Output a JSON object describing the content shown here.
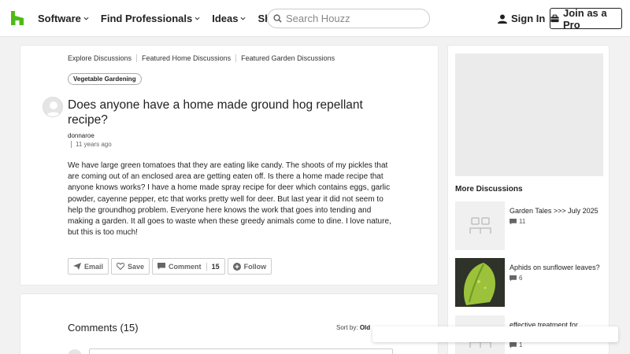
{
  "header": {
    "nav": [
      {
        "label": "Software"
      },
      {
        "label": "Find Professionals"
      },
      {
        "label": "Ideas"
      },
      {
        "label": "Shop"
      }
    ],
    "search_placeholder": "Search Houzz",
    "signin_label": "Sign In",
    "join_label": "Join as a Pro",
    "brand_color": "#4dbc15"
  },
  "breadcrumbs": [
    "Explore Discussions",
    "Featured Home Discussions",
    "Featured Garden Discussions"
  ],
  "tag": "Vegetable Gardening",
  "question": {
    "title": "Does anyone have a home made ground hog repellant recipe?",
    "author": "donnaroe",
    "time": "11 years ago",
    "body": "We have large green tomatoes that they are eating like candy. The shoots of my pickles that are coming out of an enclosed area are getting eaten off. Is there a home made recipe that anyone knows works? I have a home made spray recipe for deer which contains eggs, garlic powder, cayenne pepper, etc that works pretty well for deer. But last year it did not seem to help the groundhog problem. Everyone here knows the work that goes into tending and making a garden. It all goes to waste when these greedy animals come to dine. I love nature, but this is too much!"
  },
  "actions": {
    "email": "Email",
    "save": "Save",
    "comment": "Comment",
    "comment_count": "15",
    "follow": "Follow"
  },
  "comments": {
    "title": "Comments (15)",
    "sort_label": "Sort by:",
    "sort_value": "Old"
  },
  "sidebar": {
    "more_title": "More Discussions",
    "discussions": [
      {
        "title": "Garden Tales >>> July 2025",
        "count": "11"
      },
      {
        "title": "Aphids on sunflower leaves?",
        "count": "6"
      },
      {
        "title": "effective treatment for",
        "count": "1"
      }
    ]
  }
}
